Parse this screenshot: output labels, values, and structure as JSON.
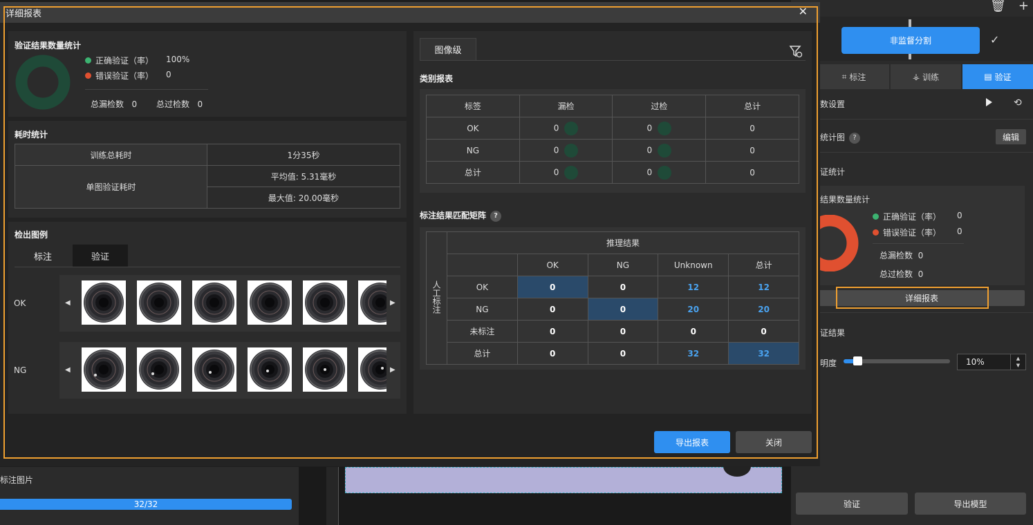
{
  "app": {
    "top_icons": [
      "trash-icon",
      "plus-icon"
    ],
    "unsupervised_button": "非监督分割",
    "mode_tabs": [
      {
        "label": "标注",
        "icon": "tag-icon"
      },
      {
        "label": "训练",
        "icon": "network-icon"
      },
      {
        "label": "验证",
        "icon": "doc-icon"
      }
    ],
    "param_settings": "数设置",
    "stat_chart": "统计图",
    "edit_label": "编辑",
    "validate_stats": "证统计",
    "result_count_stats": "结果数量统计",
    "correct_label": "正确验证（率）",
    "correct_value": "0",
    "error_label": "错误验证（率）",
    "error_value": "0",
    "missed_label": "总漏检数",
    "missed_value": "0",
    "over_label": "总过检数",
    "over_value": "0",
    "detail_report_button": "详细报表",
    "validate_result": "证结果",
    "brightness_label": "明度",
    "brightness_value": "10%",
    "brightness_fraction": 0.1,
    "validate_button": "验证",
    "export_model_button": "导出模型",
    "labeled_images": "标注图片",
    "progress_text": "32/32",
    "colors": {
      "accent": "#2f8ff0",
      "highlight": "#f0a030",
      "correct": "#3cb371",
      "error": "#e05030"
    }
  },
  "dialog": {
    "title": "详细报表",
    "stats": {
      "title": "验证结果数量统计",
      "correct_label": "正确验证（率）",
      "correct_value": "100%",
      "error_label": "错误验证（率）",
      "error_value": "0",
      "missed_label": "总漏检数",
      "missed_value": "0",
      "over_label": "总过检数",
      "over_value": "0"
    },
    "timing": {
      "title": "耗时统计",
      "train_total_label": "训练总耗时",
      "train_total_value": "1分35秒",
      "single_label": "单图验证耗时",
      "avg_value": "平均值: 5.31毫秒",
      "max_value": "最大值: 20.00毫秒"
    },
    "examples": {
      "title": "检出图例",
      "tabs": [
        "标注",
        "验证"
      ],
      "rows": [
        "OK",
        "NG"
      ]
    },
    "right_tab": "图像级",
    "category_report": {
      "title": "类别报表",
      "headers": [
        "标签",
        "漏检",
        "过检",
        "总计"
      ],
      "rows": [
        {
          "label": "OK",
          "missed": "0",
          "over": "0",
          "total": "0"
        },
        {
          "label": "NG",
          "missed": "0",
          "over": "0",
          "total": "0"
        },
        {
          "label": "总计",
          "missed": "0",
          "over": "0",
          "total": "0"
        }
      ]
    },
    "matrix": {
      "title": "标注结果匹配矩阵",
      "predicted_header": "推理结果",
      "actual_header": "人工标注",
      "columns": [
        "OK",
        "NG",
        "Unknown",
        "总计"
      ],
      "rows": [
        {
          "label": "OK",
          "cells": [
            "0",
            "0",
            "12",
            "12"
          ]
        },
        {
          "label": "NG",
          "cells": [
            "0",
            "0",
            "20",
            "20"
          ]
        },
        {
          "label": "未标注",
          "cells": [
            "0",
            "0",
            "0",
            "0"
          ]
        },
        {
          "label": "总计",
          "cells": [
            "0",
            "0",
            "32",
            "32"
          ]
        }
      ]
    },
    "export_button": "导出报表",
    "close_button": "关闭"
  }
}
